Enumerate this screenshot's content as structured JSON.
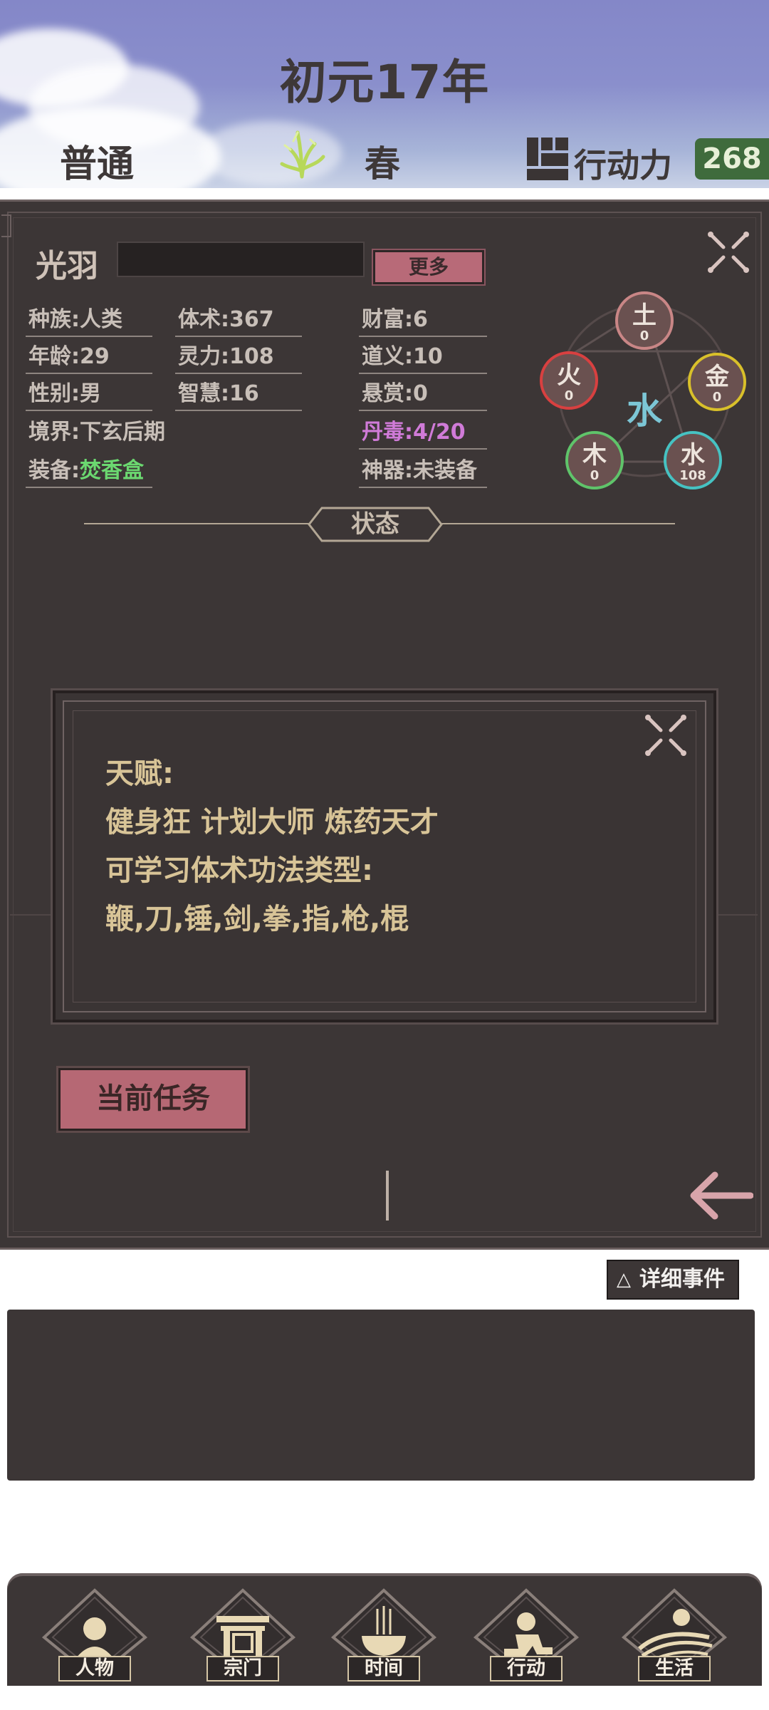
{
  "header": {
    "year": "初元17年",
    "difficulty": "普通",
    "season": "春",
    "action_label": "行动力",
    "action_points": "268"
  },
  "character": {
    "name": "光羽",
    "more_label": "更多",
    "stats": {
      "race": "种族:人类",
      "age": "年龄:29",
      "gender": "性别:男",
      "realm": "境界:下玄后期",
      "equip_label": "装备:",
      "equip_value": "焚香盒",
      "body_art": "体术:367",
      "spirit": "灵力:108",
      "wisdom": "智慧:16",
      "wealth": "财富:6",
      "righteousness": "道义:10",
      "bounty": "悬赏:0",
      "pill_toxin": "丹毒:4/20",
      "artifact": "神器:未装备"
    }
  },
  "wuxing": {
    "center": "水",
    "elements": [
      {
        "key": "earth",
        "char": "土",
        "value": "0",
        "color": "#c98686"
      },
      {
        "key": "fire",
        "char": "火",
        "value": "0",
        "color": "#d84040"
      },
      {
        "key": "metal",
        "char": "金",
        "value": "0",
        "color": "#d9c02a"
      },
      {
        "key": "wood",
        "char": "木",
        "value": "0",
        "color": "#5fc46a"
      },
      {
        "key": "water",
        "char": "水",
        "value": "108",
        "color": "#46c2c2"
      }
    ]
  },
  "status_section": {
    "title": "状态"
  },
  "talent_popup": {
    "line1": "天赋:",
    "line2": "健身狂  计划大师  炼药天才",
    "line3": "可学习体术功法类型:",
    "line4": "鞭,刀,锤,剑,拳,指,枪,棍"
  },
  "task_button": "当前任务",
  "events": {
    "detail_label": "详细事件",
    "detail_icon": "△"
  },
  "bottom_nav": [
    {
      "key": "character",
      "label": "人物"
    },
    {
      "key": "sect",
      "label": "宗门"
    },
    {
      "key": "time",
      "label": "时间"
    },
    {
      "key": "action",
      "label": "行动"
    },
    {
      "key": "life",
      "label": "生活"
    }
  ],
  "colors": {
    "panel": "#3c3636",
    "accent_pink": "#b66874",
    "gold_text": "#d8c497",
    "toxin_purple": "#d07bd8",
    "equip_green": "#6bd870",
    "ap_green": "#3f6b3c"
  }
}
